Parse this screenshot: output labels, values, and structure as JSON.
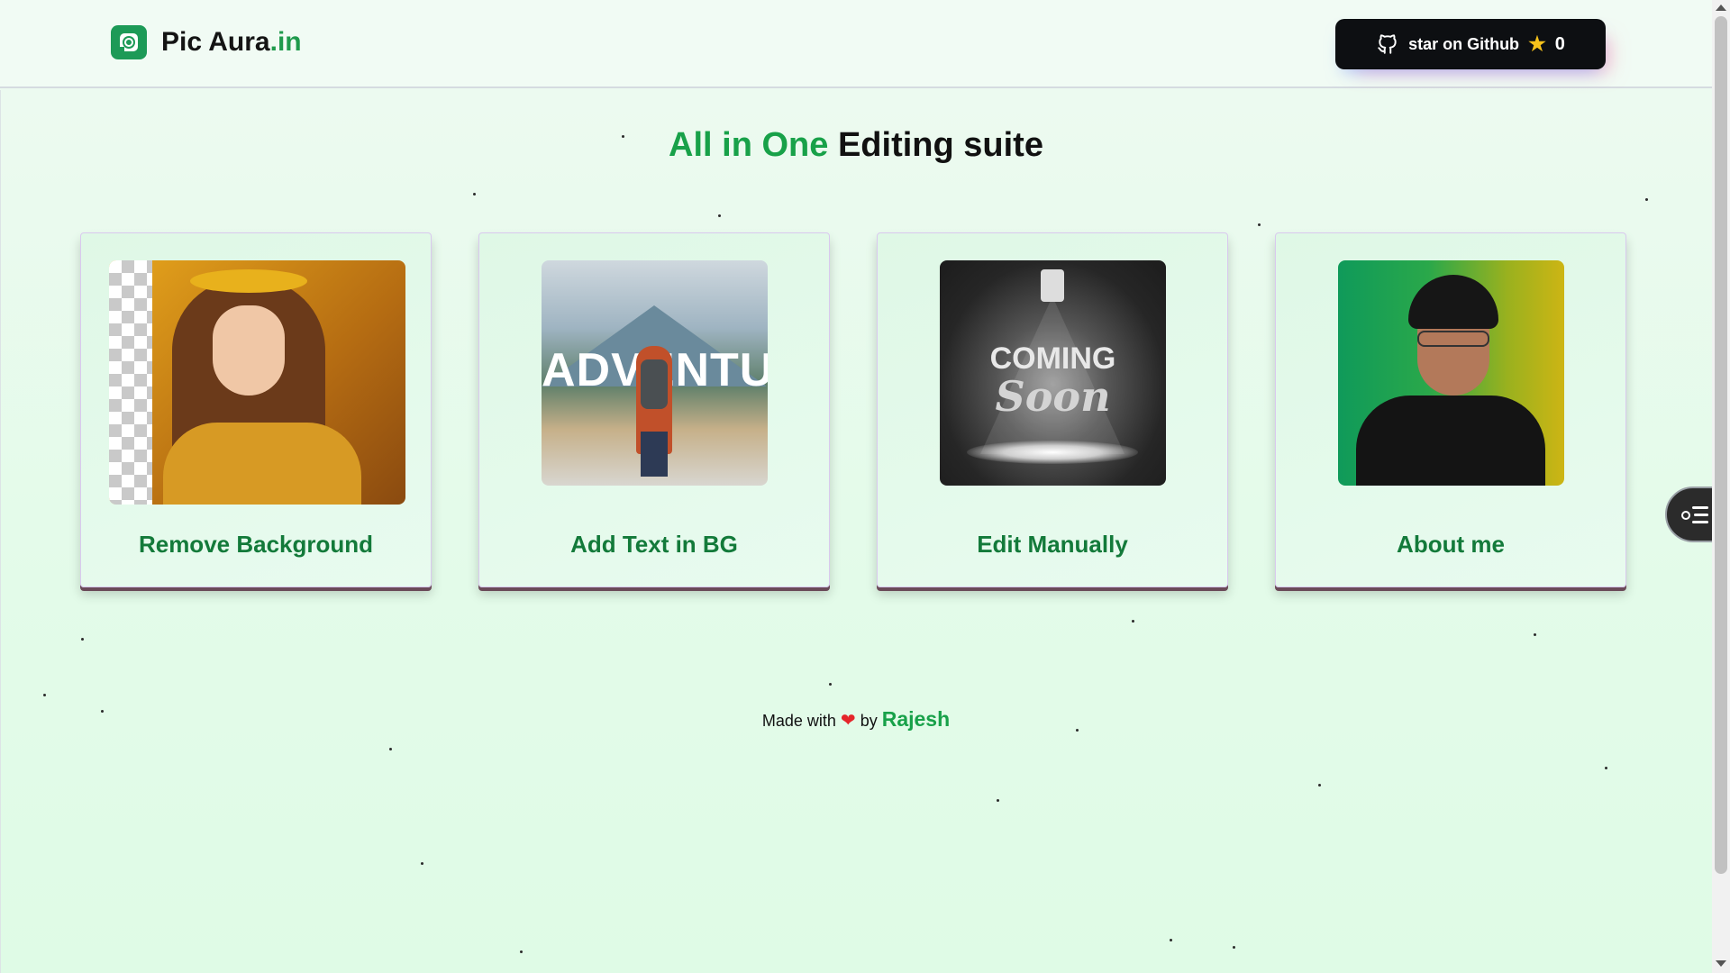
{
  "header": {
    "logo_text": "Pic Aura",
    "logo_suffix": ".in",
    "github_label": "star on Github",
    "github_star_count": "0"
  },
  "main": {
    "title_highlight": "All in One",
    "title_rest": "Editing suite",
    "cards": [
      {
        "label": "Remove Background"
      },
      {
        "label": "Add Text in BG"
      },
      {
        "label": "Edit Manually"
      },
      {
        "label": "About me"
      }
    ],
    "adventure_text": "ADVENTURE",
    "coming_text": "COMING",
    "soon_text": "Soon"
  },
  "footer": {
    "made_with": "Made with",
    "heart": "❤",
    "by": "by",
    "author": "Rajesh"
  },
  "colors": {
    "accent": "#18a149",
    "card_label": "#137a3a",
    "github_button": "#0d0f12"
  },
  "icons": [
    "logo-icon",
    "github-icon",
    "star-icon",
    "heart-icon",
    "menu-fab-icon"
  ]
}
